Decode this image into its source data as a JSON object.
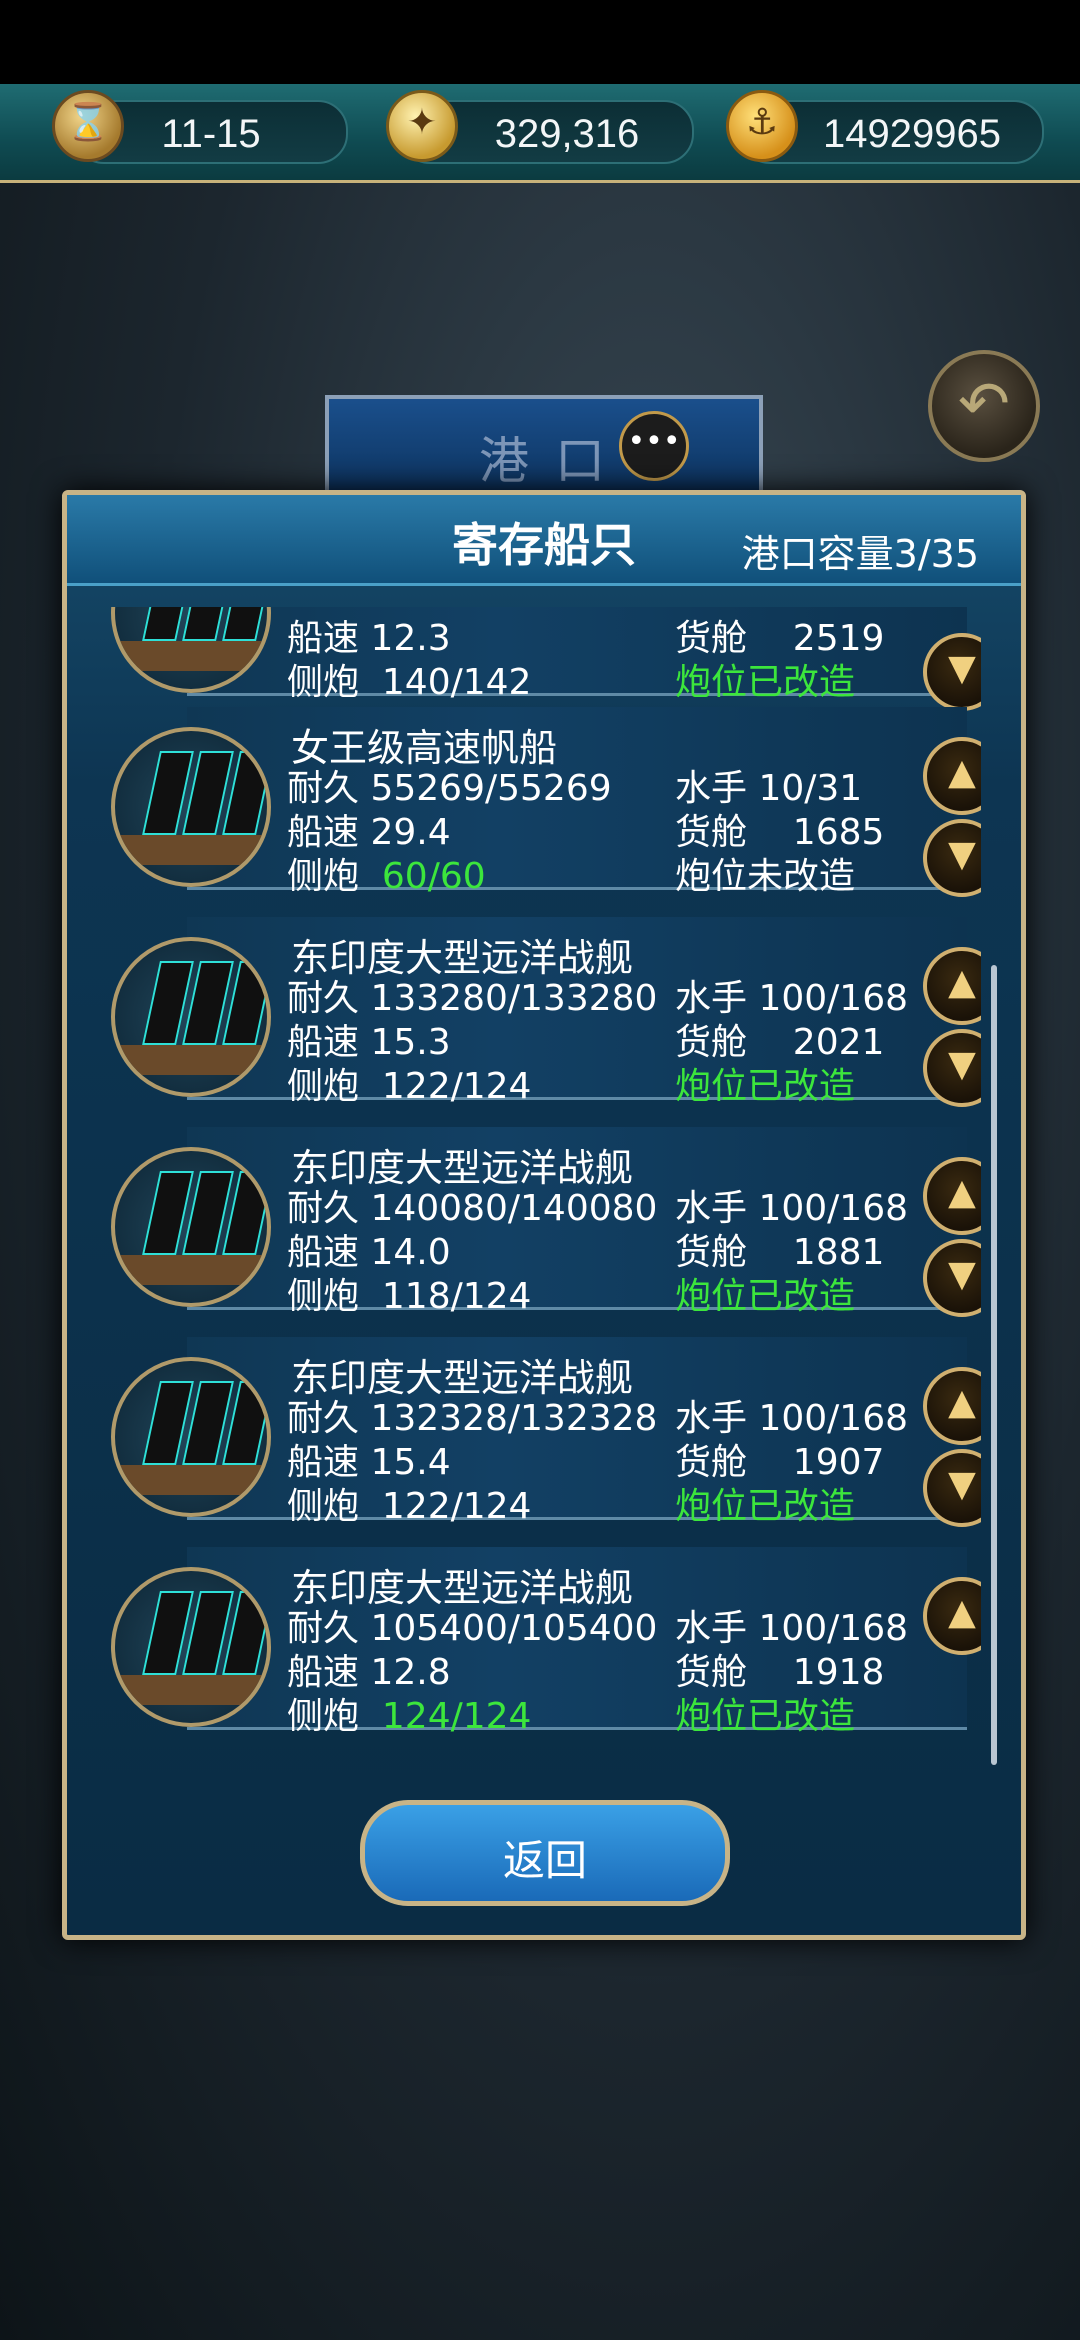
{
  "topbar": {
    "date": "11-15",
    "coins": "329,316",
    "gold": "14929965"
  },
  "port_tab": {
    "label": "港口"
  },
  "panel": {
    "title": "寄存船只",
    "capacity_label": "港口容量",
    "capacity_value": "3/35"
  },
  "labels": {
    "durability": "耐久",
    "speed": "船速",
    "cannons": "侧炮",
    "crew": "水手",
    "cargo": "货舱"
  },
  "ships": [
    {
      "name": "",
      "durability": "",
      "speed": "12.3",
      "cannons": "140/142",
      "cannons_green": false,
      "crew": "",
      "cargo": "2519",
      "mod": "炮位已改造",
      "mod_green": true,
      "up": false,
      "down": true
    },
    {
      "name": "女王级高速帆船",
      "durability": "55269/55269",
      "speed": "29.4",
      "cannons": "60/60",
      "cannons_green": true,
      "crew": "10/31",
      "cargo": "1685",
      "mod": "炮位未改造",
      "mod_green": false,
      "up": true,
      "down": true
    },
    {
      "name": "东印度大型远洋战舰",
      "durability": "133280/133280",
      "speed": "15.3",
      "cannons": "122/124",
      "cannons_green": false,
      "crew": "100/168",
      "cargo": "2021",
      "mod": "炮位已改造",
      "mod_green": true,
      "up": true,
      "down": true
    },
    {
      "name": "东印度大型远洋战舰",
      "durability": "140080/140080",
      "speed": "14.0",
      "cannons": "118/124",
      "cannons_green": false,
      "crew": "100/168",
      "cargo": "1881",
      "mod": "炮位已改造",
      "mod_green": true,
      "up": true,
      "down": true
    },
    {
      "name": "东印度大型远洋战舰",
      "durability": "132328/132328",
      "speed": "15.4",
      "cannons": "122/124",
      "cannons_green": false,
      "crew": "100/168",
      "cargo": "1907",
      "mod": "炮位已改造",
      "mod_green": true,
      "up": true,
      "down": true
    },
    {
      "name": "东印度大型远洋战舰",
      "durability": "105400/105400",
      "speed": "12.8",
      "cannons": "124/124",
      "cannons_green": true,
      "crew": "100/168",
      "cargo": "1918",
      "mod": "炮位已改造",
      "mod_green": true,
      "up": true,
      "down": false
    }
  ],
  "return_label": "返回"
}
